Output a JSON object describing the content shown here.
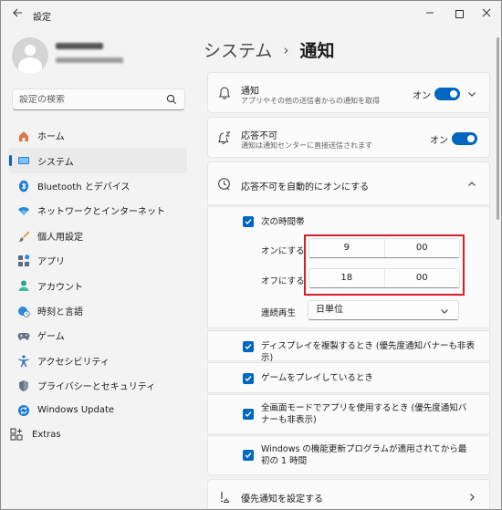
{
  "window": {
    "title": "設定"
  },
  "search": {
    "placeholder": "設定の検索"
  },
  "nav": [
    {
      "label": "ホーム",
      "icon": "home-icon"
    },
    {
      "label": "システム",
      "icon": "display-icon",
      "active": true
    },
    {
      "label": "Bluetooth とデバイス",
      "icon": "bluetooth-icon"
    },
    {
      "label": "ネットワークとインターネット",
      "icon": "wifi-icon"
    },
    {
      "label": "個人用設定",
      "icon": "brush-icon"
    },
    {
      "label": "アプリ",
      "icon": "apps-icon"
    },
    {
      "label": "アカウント",
      "icon": "person-icon"
    },
    {
      "label": "時刻と言語",
      "icon": "globe-clock-icon"
    },
    {
      "label": "ゲーム",
      "icon": "gamepad-icon"
    },
    {
      "label": "アクセシビリティ",
      "icon": "accessibility-icon"
    },
    {
      "label": "プライバシーとセキュリティ",
      "icon": "shield-icon"
    },
    {
      "label": "Windows Update",
      "icon": "update-icon"
    }
  ],
  "extras": {
    "label": "Extras"
  },
  "breadcrumb": {
    "parent": "システム",
    "separator": "›",
    "current": "通知"
  },
  "notifications": {
    "title": "通知",
    "subtitle": "アプリやその他の送信者からの通知を取得",
    "state": "オン"
  },
  "dnd": {
    "title": "応答不可",
    "subtitle": "通知は通知センターに直接送信されます",
    "state": "オン"
  },
  "auto_dnd": {
    "title": "応答不可を自動的にオンにする",
    "time_period": "次の時間帯",
    "on_label": "オンにする",
    "on_hour": "9",
    "on_minute": "00",
    "off_label": "オフにする",
    "off_hour": "18",
    "off_minute": "00",
    "repeat_label": "連続再生",
    "repeat_value": "日単位",
    "options": [
      "ディスプレイを複製するとき (優先度通知バナーも非表示)",
      "ゲームをプレイしているとき",
      "全画面モードでアプリを使用するとき (優先度通知バナーも非表示)",
      "Windows の機能更新プログラムが適用されてから最初の 1 時間"
    ]
  },
  "priority": {
    "title": "優先通知を設定する"
  },
  "colors": {
    "accent": "#0067c0",
    "highlight": "#d81e2a"
  }
}
